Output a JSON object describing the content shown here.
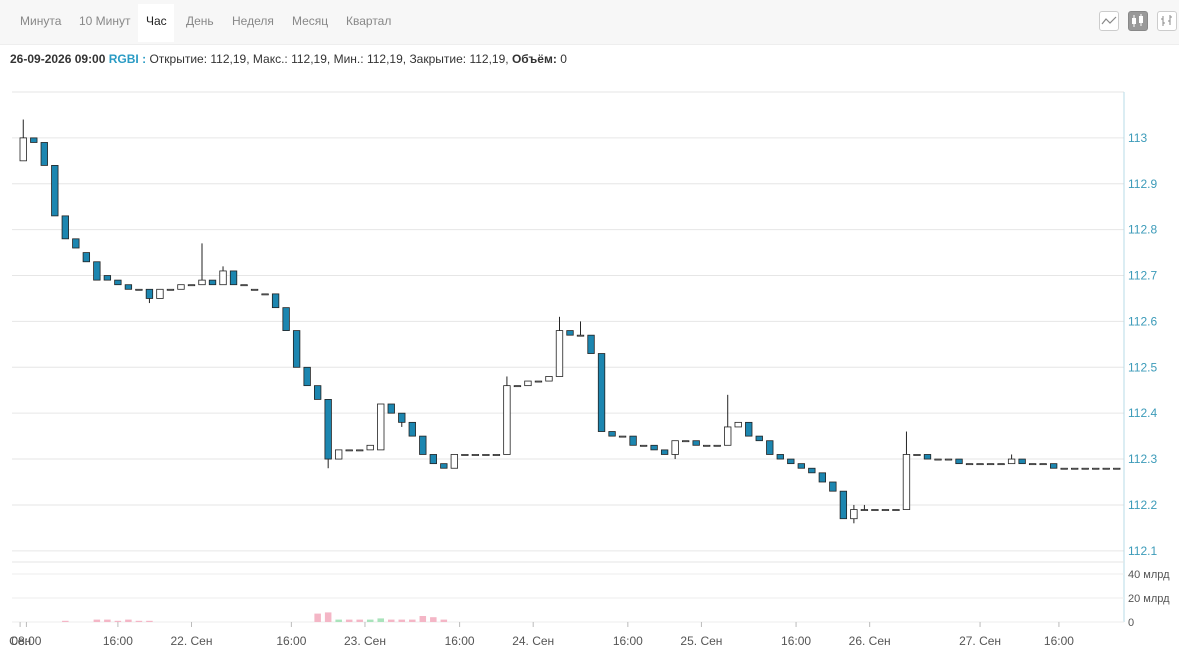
{
  "tabs": [
    {
      "label": "Минута",
      "active": false
    },
    {
      "label": "10 Минут",
      "active": false
    },
    {
      "label": "Час",
      "active": true
    },
    {
      "label": "День",
      "active": false
    },
    {
      "label": "Неделя",
      "active": false
    },
    {
      "label": "Месяц",
      "active": false
    },
    {
      "label": "Квартал",
      "active": false
    }
  ],
  "toolbar": {
    "icons": [
      "line-chart-icon",
      "candlestick-chart-icon",
      "ohlc-bar-chart-icon"
    ],
    "active_icon": "candlestick-chart-icon"
  },
  "info": {
    "datetime": "26-09-2026 09:00",
    "ticker": "RGBI :",
    "open_label": "Открытие:",
    "open_value": "112,19,",
    "high_label": "Макс.:",
    "high_value": "112,19,",
    "low_label": "Мин.:",
    "low_value": "112,19,",
    "close_label": "Закрытие:",
    "close_value": "112,19,",
    "volume_label": "Объём:",
    "volume_value": "0"
  },
  "colors": {
    "down": "#1c86b0",
    "up": "#ffffff",
    "vol_down": "#f4b6c6",
    "vol_up": "#a9e3bb",
    "axis_text": "#3c9bb9"
  },
  "chart_data": [
    {
      "type": "candlestick",
      "title": "",
      "ylim": [
        112.08,
        113.1
      ],
      "yticks": [
        "113",
        "112.9",
        "112.8",
        "112.7",
        "112.6",
        "112.5",
        "112.4",
        "112.3",
        "112.2",
        "112.1"
      ],
      "xticks": [
        "Сен",
        "08:00",
        "16:00",
        "22. Сен",
        "16:00",
        "23. Сен",
        "16:00",
        "24. Сен",
        "16:00",
        "25. Сен",
        "16:00",
        "26. Сен",
        "27. Сен",
        "16:00"
      ],
      "grid": true,
      "candles": [
        {
          "o": 112.95,
          "h": 113.04,
          "l": 112.95,
          "c": 113.0
        },
        {
          "o": 113.0,
          "h": 113.0,
          "l": 112.99,
          "c": 112.99
        },
        {
          "o": 112.99,
          "h": 112.99,
          "l": 112.94,
          "c": 112.94
        },
        {
          "o": 112.94,
          "h": 112.94,
          "l": 112.83,
          "c": 112.83
        },
        {
          "o": 112.83,
          "h": 112.83,
          "l": 112.78,
          "c": 112.78
        },
        {
          "o": 112.78,
          "h": 112.78,
          "l": 112.76,
          "c": 112.76
        },
        {
          "o": 112.75,
          "h": 112.75,
          "l": 112.73,
          "c": 112.73
        },
        {
          "o": 112.73,
          "h": 112.73,
          "l": 112.69,
          "c": 112.69
        },
        {
          "o": 112.7,
          "h": 112.7,
          "l": 112.69,
          "c": 112.69
        },
        {
          "o": 112.69,
          "h": 112.69,
          "l": 112.68,
          "c": 112.68
        },
        {
          "o": 112.68,
          "h": 112.68,
          "l": 112.67,
          "c": 112.67
        },
        {
          "o": 112.67,
          "h": 112.67,
          "l": 112.67,
          "c": 112.67
        },
        {
          "o": 112.67,
          "h": 112.67,
          "l": 112.64,
          "c": 112.65
        },
        {
          "o": 112.65,
          "h": 112.67,
          "l": 112.65,
          "c": 112.67
        },
        {
          "o": 112.67,
          "h": 112.67,
          "l": 112.67,
          "c": 112.67
        },
        {
          "o": 112.67,
          "h": 112.68,
          "l": 112.67,
          "c": 112.68
        },
        {
          "o": 112.68,
          "h": 112.68,
          "l": 112.68,
          "c": 112.68
        },
        {
          "o": 112.68,
          "h": 112.77,
          "l": 112.68,
          "c": 112.69
        },
        {
          "o": 112.69,
          "h": 112.69,
          "l": 112.68,
          "c": 112.68
        },
        {
          "o": 112.68,
          "h": 112.72,
          "l": 112.68,
          "c": 112.71
        },
        {
          "o": 112.71,
          "h": 112.71,
          "l": 112.68,
          "c": 112.68
        },
        {
          "o": 112.68,
          "h": 112.68,
          "l": 112.68,
          "c": 112.68
        },
        {
          "o": 112.67,
          "h": 112.67,
          "l": 112.67,
          "c": 112.67
        },
        {
          "o": 112.66,
          "h": 112.66,
          "l": 112.66,
          "c": 112.66
        },
        {
          "o": 112.66,
          "h": 112.66,
          "l": 112.63,
          "c": 112.63
        },
        {
          "o": 112.63,
          "h": 112.63,
          "l": 112.58,
          "c": 112.58
        },
        {
          "o": 112.58,
          "h": 112.58,
          "l": 112.5,
          "c": 112.5
        },
        {
          "o": 112.5,
          "h": 112.5,
          "l": 112.46,
          "c": 112.46
        },
        {
          "o": 112.46,
          "h": 112.46,
          "l": 112.43,
          "c": 112.43
        },
        {
          "o": 112.43,
          "h": 112.43,
          "l": 112.28,
          "c": 112.3
        },
        {
          "o": 112.3,
          "h": 112.32,
          "l": 112.3,
          "c": 112.32
        },
        {
          "o": 112.32,
          "h": 112.32,
          "l": 112.32,
          "c": 112.32
        },
        {
          "o": 112.32,
          "h": 112.32,
          "l": 112.32,
          "c": 112.32
        },
        {
          "o": 112.32,
          "h": 112.33,
          "l": 112.32,
          "c": 112.33
        },
        {
          "o": 112.32,
          "h": 112.42,
          "l": 112.32,
          "c": 112.42
        },
        {
          "o": 112.42,
          "h": 112.42,
          "l": 112.4,
          "c": 112.4
        },
        {
          "o": 112.4,
          "h": 112.4,
          "l": 112.37,
          "c": 112.38
        },
        {
          "o": 112.38,
          "h": 112.38,
          "l": 112.35,
          "c": 112.35
        },
        {
          "o": 112.35,
          "h": 112.35,
          "l": 112.31,
          "c": 112.31
        },
        {
          "o": 112.31,
          "h": 112.31,
          "l": 112.29,
          "c": 112.29
        },
        {
          "o": 112.29,
          "h": 112.29,
          "l": 112.28,
          "c": 112.28
        },
        {
          "o": 112.28,
          "h": 112.31,
          "l": 112.28,
          "c": 112.31
        },
        {
          "o": 112.31,
          "h": 112.31,
          "l": 112.31,
          "c": 112.31
        },
        {
          "o": 112.31,
          "h": 112.31,
          "l": 112.31,
          "c": 112.31
        },
        {
          "o": 112.31,
          "h": 112.31,
          "l": 112.31,
          "c": 112.31
        },
        {
          "o": 112.31,
          "h": 112.31,
          "l": 112.31,
          "c": 112.31
        },
        {
          "o": 112.31,
          "h": 112.48,
          "l": 112.31,
          "c": 112.46
        },
        {
          "o": 112.46,
          "h": 112.46,
          "l": 112.46,
          "c": 112.46
        },
        {
          "o": 112.46,
          "h": 112.46,
          "l": 112.46,
          "c": 112.47
        },
        {
          "o": 112.47,
          "h": 112.47,
          "l": 112.47,
          "c": 112.47
        },
        {
          "o": 112.47,
          "h": 112.48,
          "l": 112.47,
          "c": 112.48
        },
        {
          "o": 112.48,
          "h": 112.61,
          "l": 112.48,
          "c": 112.58
        },
        {
          "o": 112.58,
          "h": 112.58,
          "l": 112.57,
          "c": 112.57
        },
        {
          "o": 112.57,
          "h": 112.6,
          "l": 112.57,
          "c": 112.57
        },
        {
          "o": 112.57,
          "h": 112.57,
          "l": 112.53,
          "c": 112.53
        },
        {
          "o": 112.53,
          "h": 112.53,
          "l": 112.36,
          "c": 112.36
        },
        {
          "o": 112.36,
          "h": 112.36,
          "l": 112.35,
          "c": 112.35
        },
        {
          "o": 112.35,
          "h": 112.35,
          "l": 112.35,
          "c": 112.35
        },
        {
          "o": 112.35,
          "h": 112.35,
          "l": 112.33,
          "c": 112.33
        },
        {
          "o": 112.33,
          "h": 112.33,
          "l": 112.33,
          "c": 112.33
        },
        {
          "o": 112.33,
          "h": 112.33,
          "l": 112.32,
          "c": 112.32
        },
        {
          "o": 112.32,
          "h": 112.32,
          "l": 112.31,
          "c": 112.31
        },
        {
          "o": 112.31,
          "h": 112.34,
          "l": 112.3,
          "c": 112.34
        },
        {
          "o": 112.34,
          "h": 112.34,
          "l": 112.34,
          "c": 112.34
        },
        {
          "o": 112.34,
          "h": 112.34,
          "l": 112.33,
          "c": 112.33
        },
        {
          "o": 112.33,
          "h": 112.33,
          "l": 112.33,
          "c": 112.33
        },
        {
          "o": 112.33,
          "h": 112.33,
          "l": 112.33,
          "c": 112.33
        },
        {
          "o": 112.33,
          "h": 112.44,
          "l": 112.33,
          "c": 112.37
        },
        {
          "o": 112.37,
          "h": 112.38,
          "l": 112.37,
          "c": 112.38
        },
        {
          "o": 112.38,
          "h": 112.38,
          "l": 112.35,
          "c": 112.35
        },
        {
          "o": 112.35,
          "h": 112.35,
          "l": 112.34,
          "c": 112.34
        },
        {
          "o": 112.34,
          "h": 112.34,
          "l": 112.31,
          "c": 112.31
        },
        {
          "o": 112.31,
          "h": 112.31,
          "l": 112.3,
          "c": 112.3
        },
        {
          "o": 112.3,
          "h": 112.3,
          "l": 112.29,
          "c": 112.29
        },
        {
          "o": 112.29,
          "h": 112.29,
          "l": 112.28,
          "c": 112.28
        },
        {
          "o": 112.28,
          "h": 112.28,
          "l": 112.27,
          "c": 112.27
        },
        {
          "o": 112.27,
          "h": 112.27,
          "l": 112.25,
          "c": 112.25
        },
        {
          "o": 112.25,
          "h": 112.25,
          "l": 112.23,
          "c": 112.23
        },
        {
          "o": 112.23,
          "h": 112.23,
          "l": 112.17,
          "c": 112.17
        },
        {
          "o": 112.17,
          "h": 112.2,
          "l": 112.16,
          "c": 112.19
        },
        {
          "o": 112.19,
          "h": 112.2,
          "l": 112.19,
          "c": 112.19
        },
        {
          "o": 112.19,
          "h": 112.19,
          "l": 112.19,
          "c": 112.19
        },
        {
          "o": 112.19,
          "h": 112.19,
          "l": 112.19,
          "c": 112.19
        },
        {
          "o": 112.19,
          "h": 112.19,
          "l": 112.19,
          "c": 112.19
        },
        {
          "o": 112.19,
          "h": 112.36,
          "l": 112.19,
          "c": 112.31
        },
        {
          "o": 112.31,
          "h": 112.31,
          "l": 112.31,
          "c": 112.31
        },
        {
          "o": 112.31,
          "h": 112.31,
          "l": 112.3,
          "c": 112.3
        },
        {
          "o": 112.3,
          "h": 112.3,
          "l": 112.3,
          "c": 112.3
        },
        {
          "o": 112.3,
          "h": 112.3,
          "l": 112.3,
          "c": 112.3
        },
        {
          "o": 112.3,
          "h": 112.3,
          "l": 112.29,
          "c": 112.29
        },
        {
          "o": 112.29,
          "h": 112.29,
          "l": 112.29,
          "c": 112.29
        },
        {
          "o": 112.29,
          "h": 112.29,
          "l": 112.29,
          "c": 112.29
        },
        {
          "o": 112.29,
          "h": 112.29,
          "l": 112.29,
          "c": 112.29
        },
        {
          "o": 112.29,
          "h": 112.29,
          "l": 112.29,
          "c": 112.29
        },
        {
          "o": 112.29,
          "h": 112.31,
          "l": 112.29,
          "c": 112.3
        },
        {
          "o": 112.3,
          "h": 112.3,
          "l": 112.29,
          "c": 112.29
        },
        {
          "o": 112.29,
          "h": 112.29,
          "l": 112.29,
          "c": 112.29
        },
        {
          "o": 112.29,
          "h": 112.29,
          "l": 112.29,
          "c": 112.29
        },
        {
          "o": 112.29,
          "h": 112.29,
          "l": 112.28,
          "c": 112.28
        },
        {
          "o": 112.28,
          "h": 112.28,
          "l": 112.28,
          "c": 112.28
        },
        {
          "o": 112.28,
          "h": 112.28,
          "l": 112.28,
          "c": 112.28
        },
        {
          "o": 112.28,
          "h": 112.28,
          "l": 112.28,
          "c": 112.28
        },
        {
          "o": 112.28,
          "h": 112.28,
          "l": 112.28,
          "c": 112.28
        },
        {
          "o": 112.28,
          "h": 112.28,
          "l": 112.28,
          "c": 112.28
        },
        {
          "o": 112.28,
          "h": 112.28,
          "l": 112.28,
          "c": 112.28
        }
      ]
    },
    {
      "type": "bar",
      "title": "",
      "ylabel": "",
      "unit": "млрд",
      "ylim": [
        0,
        50
      ],
      "yticks": [
        "40 млрд",
        "20 млрд",
        "0"
      ],
      "volumes": [
        0,
        0,
        0,
        0,
        1,
        0,
        0,
        2,
        2,
        1,
        2,
        1,
        1,
        0,
        0,
        0,
        0,
        0,
        0,
        0,
        0,
        0,
        0,
        0,
        0,
        0,
        0,
        0,
        7,
        8,
        2,
        2,
        2,
        2,
        3,
        2,
        2,
        2,
        5,
        4,
        2,
        0,
        0,
        0,
        0,
        0,
        0,
        0,
        0,
        0,
        0,
        0,
        0,
        0,
        0,
        0,
        0,
        0,
        0,
        0,
        0,
        0,
        0,
        0,
        0,
        0,
        0,
        0,
        0,
        0,
        0,
        0,
        0,
        0,
        0,
        0,
        0,
        0,
        0,
        0,
        0,
        0,
        0,
        0,
        0,
        0,
        0,
        0,
        0,
        0,
        0,
        0,
        0,
        0,
        0,
        0,
        0,
        0,
        0,
        0,
        0,
        0,
        0,
        0,
        0,
        0,
        0,
        0
      ]
    }
  ]
}
